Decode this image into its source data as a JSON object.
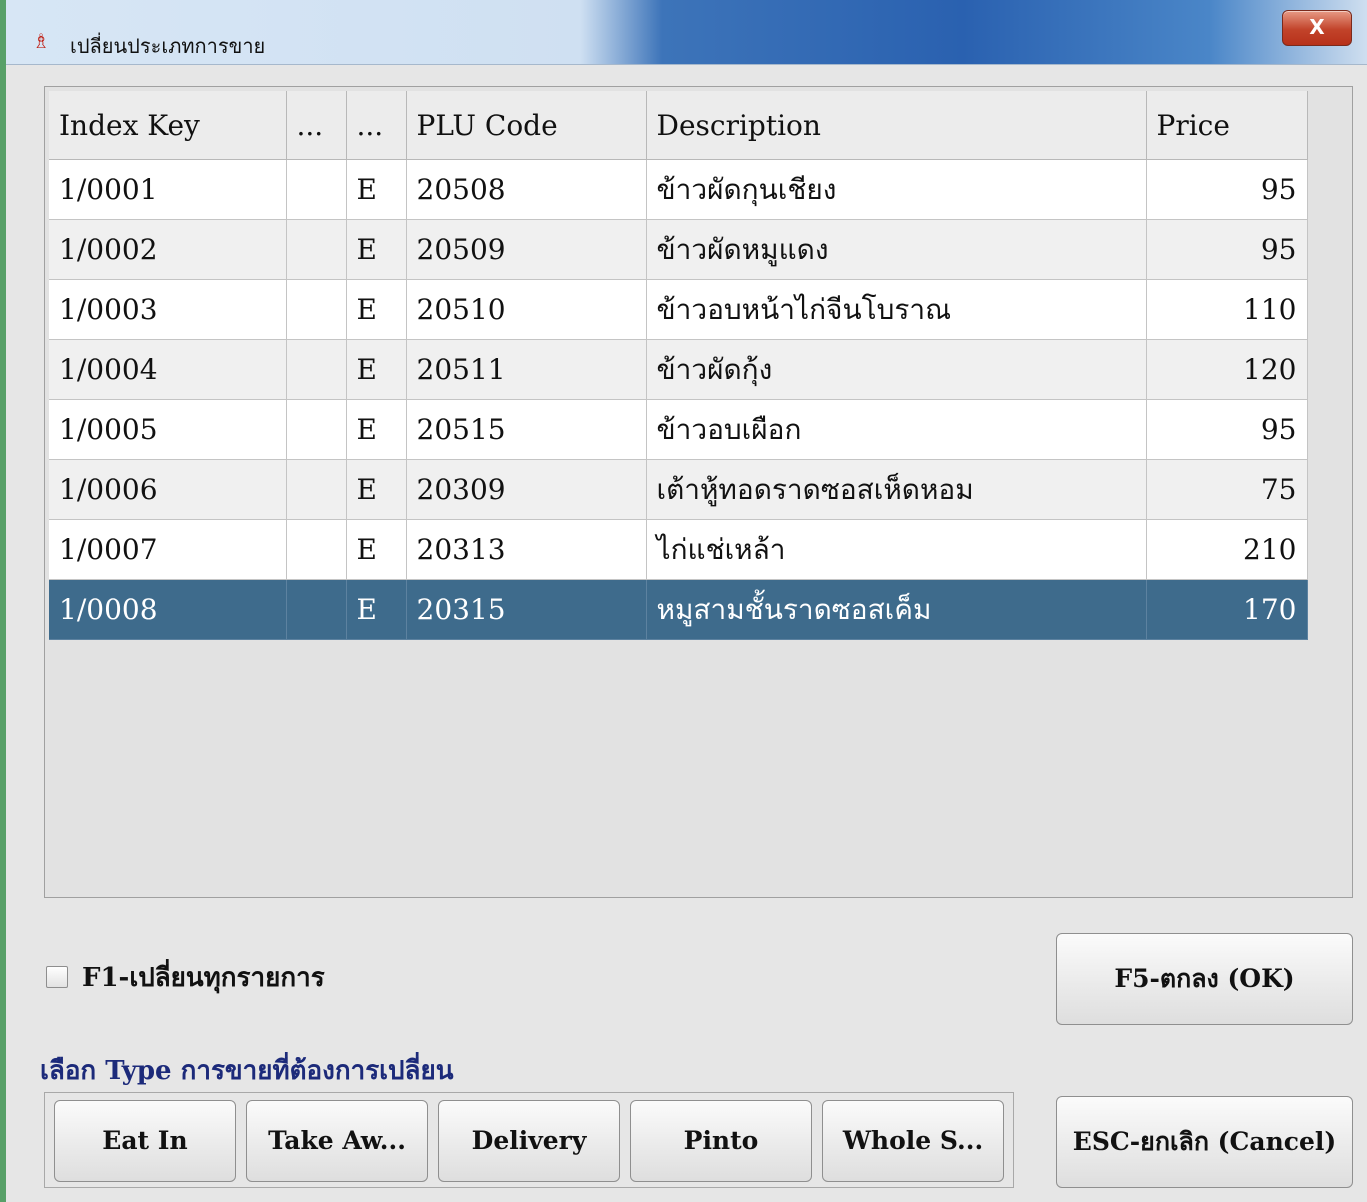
{
  "window": {
    "title": "เปลี่ยนประเภทการขาย",
    "close_label": "X"
  },
  "table": {
    "columns": [
      "Index Key",
      "...",
      "...",
      "PLU Code",
      "Description",
      "Price"
    ],
    "rows": [
      {
        "index_key": "1/0001",
        "c1": "",
        "c2": "E",
        "plu": "20508",
        "desc": "ข้าวผัดกุนเชียง",
        "price": "95"
      },
      {
        "index_key": "1/0002",
        "c1": "",
        "c2": "E",
        "plu": "20509",
        "desc": "ข้าวผัดหมูแดง",
        "price": "95"
      },
      {
        "index_key": "1/0003",
        "c1": "",
        "c2": "E",
        "plu": "20510",
        "desc": "ข้าวอบหน้าไก่จีนโบราณ",
        "price": "110"
      },
      {
        "index_key": "1/0004",
        "c1": "",
        "c2": "E",
        "plu": "20511",
        "desc": "ข้าวผัดกุ้ง",
        "price": "120"
      },
      {
        "index_key": "1/0005",
        "c1": "",
        "c2": "E",
        "plu": "20515",
        "desc": "ข้าวอบเผือก",
        "price": "95"
      },
      {
        "index_key": "1/0006",
        "c1": "",
        "c2": "E",
        "plu": "20309",
        "desc": "เต้าหู้ทอดราดซอสเห็ดหอม",
        "price": "75"
      },
      {
        "index_key": "1/0007",
        "c1": "",
        "c2": "E",
        "plu": "20313",
        "desc": "ไก่แช่เหล้า",
        "price": "210"
      },
      {
        "index_key": "1/0008",
        "c1": "",
        "c2": "E",
        "plu": "20315",
        "desc": "หมูสามชั้นราดซอสเค็ม",
        "price": "170"
      }
    ],
    "selected_row": 8
  },
  "options": {
    "change_all_label": "F1-เปลี่ยนทุกรายการ",
    "change_all_checked": false
  },
  "type_section": {
    "label": "เลือก Type การขายที่ต้องการเปลี่ยน",
    "buttons": [
      "Eat In",
      "Take Aw...",
      "Delivery",
      "Pinto",
      "Whole S..."
    ]
  },
  "actions": {
    "ok_label": "F5-ตกลง (OK)",
    "cancel_label": "ESC-ยกเลิก (Cancel)"
  },
  "colors": {
    "selected_row": "#3e6b8c",
    "close_button": "#c2432a",
    "type_label": "#1c2a7a"
  }
}
